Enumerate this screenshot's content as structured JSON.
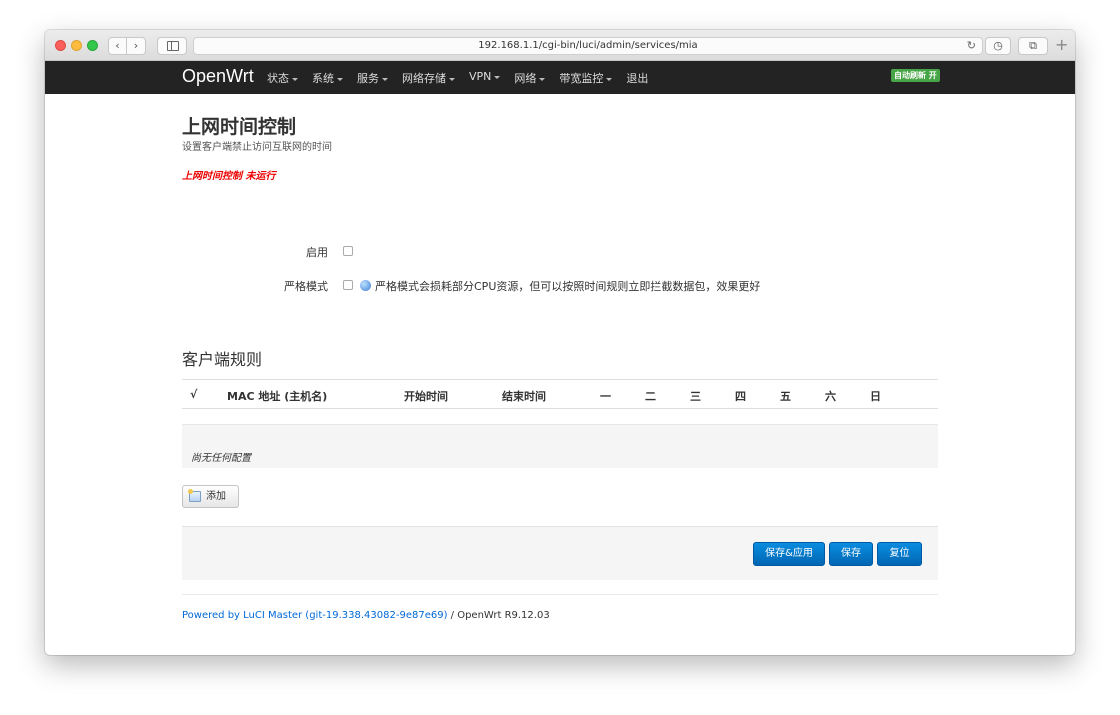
{
  "browser": {
    "url": "192.168.1.1/cgi-bin/luci/admin/services/mia",
    "back_icon": "‹",
    "forward_icon": "›",
    "reload_icon": "↻",
    "history_icon": "◷",
    "tabs_icon": "⧉",
    "new_tab_icon": "+"
  },
  "header": {
    "brand": "OpenWrt",
    "menu": [
      "状态",
      "系统",
      "服务",
      "网络存储",
      "VPN",
      "网络",
      "带宽监控",
      "退出"
    ],
    "refresh_badge": "自动刷新 开"
  },
  "page": {
    "title": "上网时间控制",
    "description": "设置客户端禁止访问互联网的时间",
    "status": "上网时间控制 未运行"
  },
  "form": {
    "enable_label": "启用",
    "strict_label": "严格模式",
    "strict_help": "严格模式会损耗部分CPU资源，但可以按照时间规则立即拦截数据包，效果更好"
  },
  "rules": {
    "section_title": "客户端规则",
    "columns": [
      "√",
      "MAC 地址 (主机名)",
      "开始时间",
      "结束时间",
      "一",
      "二",
      "三",
      "四",
      "五",
      "六",
      "日"
    ],
    "empty_text": "尚无任何配置",
    "add_label": "添加"
  },
  "actions": {
    "save_apply": "保存&应用",
    "save": "保存",
    "reset": "复位"
  },
  "footer": {
    "link": "Powered by LuCI Master (git-19.338.43082-9e87e69)",
    "suffix": " / OpenWrt R9.12.03"
  }
}
